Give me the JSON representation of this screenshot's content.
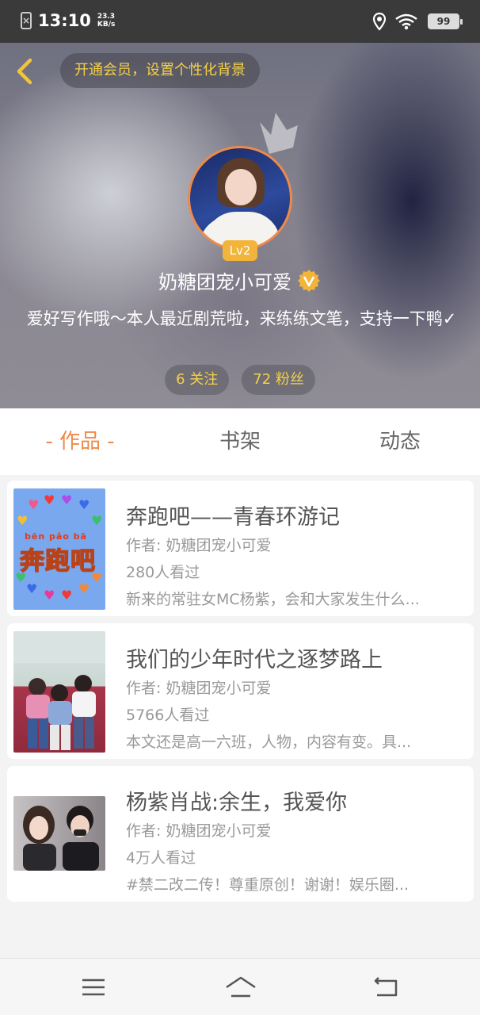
{
  "status_bar": {
    "time": "13:10",
    "net_speed_value": "23.3",
    "net_speed_unit": "KB/s",
    "battery": "99"
  },
  "header": {
    "vip_banner": "开通会员，设置个性化背景",
    "level": "Lv2",
    "username": "奶糖团宠小可爱",
    "bio": "爱好写作哦～本人最近剧荒啦，来练练文笔，支持一下鸭✓",
    "following": "6 关注",
    "followers": "72 粉丝"
  },
  "tabs": [
    "- 作品 -",
    "书架",
    "动态"
  ],
  "works": [
    {
      "title": "奔跑吧——青春环游记",
      "author": "作者: 奶糖团宠小可爱",
      "views": "280人看过",
      "desc": "新来的常驻女MC杨紫，会和大家发生什么...",
      "cover_pinyin": "bēn pǎo bā",
      "cover_title": "奔跑吧"
    },
    {
      "title": "我们的少年时代之逐梦路上",
      "author": "作者: 奶糖团宠小可爱",
      "views": "5766人看过",
      "desc": "本文还是高一六班，人物，内容有变。具..."
    },
    {
      "title": "杨紫肖战:余生，我爱你",
      "author": "作者: 奶糖团宠小可爱",
      "views": "4万人看过",
      "desc": "#禁二改二传！尊重原创！谢谢！娱乐圈..."
    }
  ],
  "colors": {
    "accent": "#ee8a4a",
    "gold": "#f5d04a"
  }
}
